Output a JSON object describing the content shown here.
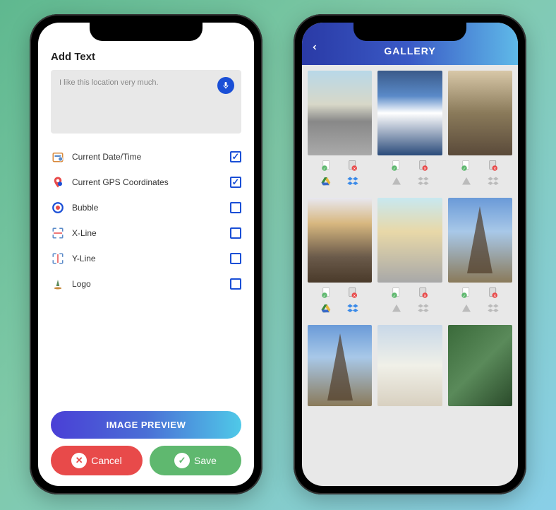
{
  "left": {
    "title": "Add Text",
    "text_input": "I like this location very much.",
    "options": [
      {
        "label": "Current Date/Time",
        "checked": true,
        "icon": "datetime"
      },
      {
        "label": "Current GPS Coordinates",
        "checked": true,
        "icon": "gps"
      },
      {
        "label": "Bubble",
        "checked": false,
        "icon": "bubble"
      },
      {
        "label": "X-Line",
        "checked": false,
        "icon": "xline"
      },
      {
        "label": "Y-Line",
        "checked": false,
        "icon": "yline"
      },
      {
        "label": "Logo",
        "checked": false,
        "icon": "logo"
      }
    ],
    "preview_button": "IMAGE PREVIEW",
    "cancel_button": "Cancel",
    "save_button": "Save"
  },
  "right": {
    "title": "GALLERY",
    "photos": [
      {
        "thumb": "building"
      },
      {
        "thumb": "mountain"
      },
      {
        "thumb": "worker"
      },
      {
        "thumb": "rails"
      },
      {
        "thumb": "crane"
      },
      {
        "thumb": "eiffel"
      },
      {
        "thumb": "eiffel"
      },
      {
        "thumb": "white"
      },
      {
        "thumb": "plant"
      }
    ]
  }
}
